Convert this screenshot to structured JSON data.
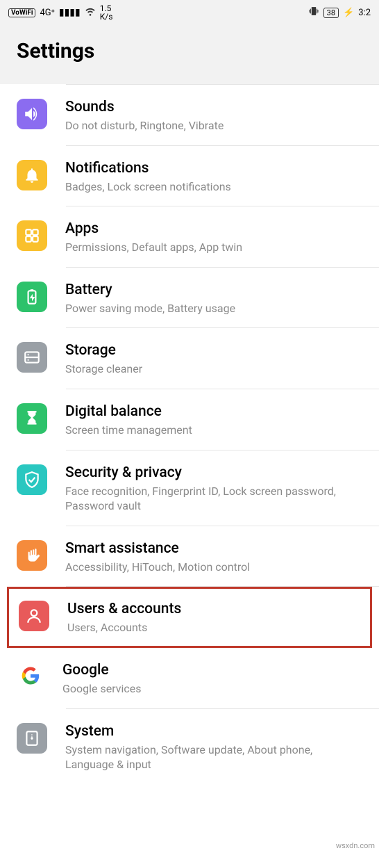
{
  "status": {
    "vowifi": "VoWiFi",
    "network": "4G⁺",
    "speed_value": "1.5",
    "speed_unit": "K/s",
    "battery": "38",
    "time": "3:2"
  },
  "header": {
    "title": "Settings"
  },
  "items": [
    {
      "title": "Sounds",
      "subtitle": "Do not disturb, Ringtone, Vibrate",
      "color": "#8b6cf0",
      "highlighted": false
    },
    {
      "title": "Notifications",
      "subtitle": "Badges, Lock screen notifications",
      "color": "#f9c02d",
      "highlighted": false
    },
    {
      "title": "Apps",
      "subtitle": "Permissions, Default apps, App twin",
      "color": "#f9c02d",
      "highlighted": false
    },
    {
      "title": "Battery",
      "subtitle": "Power saving mode, Battery usage",
      "color": "#2dc26b",
      "highlighted": false
    },
    {
      "title": "Storage",
      "subtitle": "Storage cleaner",
      "color": "#9aa0a6",
      "highlighted": false
    },
    {
      "title": "Digital balance",
      "subtitle": "Screen time management",
      "color": "#2dc26b",
      "highlighted": false
    },
    {
      "title": "Security & privacy",
      "subtitle": "Face recognition, Fingerprint ID, Lock screen password, Password vault",
      "color": "#29c7c0",
      "highlighted": false
    },
    {
      "title": "Smart assistance",
      "subtitle": "Accessibility, HiTouch, Motion control",
      "color": "#f58b3c",
      "highlighted": false
    },
    {
      "title": "Users & accounts",
      "subtitle": "Users, Accounts",
      "color": "#e85a5a",
      "highlighted": true
    },
    {
      "title": "Google",
      "subtitle": "Google services",
      "color": "#ffffff",
      "highlighted": false
    },
    {
      "title": "System",
      "subtitle": "System navigation, Software update, About phone, Language & input",
      "color": "#9aa0a6",
      "highlighted": false
    }
  ],
  "watermark": "wsxdn.com"
}
